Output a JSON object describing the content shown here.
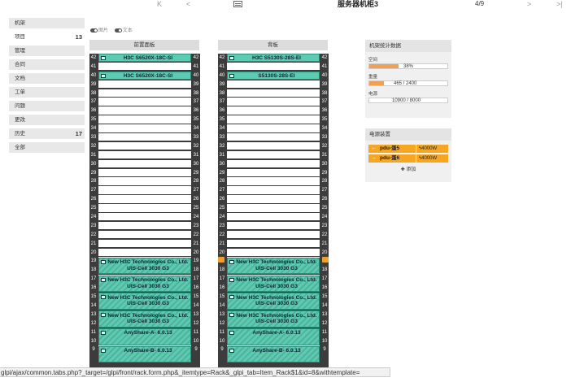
{
  "nav": {
    "first": "K",
    "prev": "<",
    "next": ">",
    "last": ">|",
    "title": "服务器机柜3",
    "counter": "4/9"
  },
  "sidebar": {
    "items": [
      {
        "label": "机架",
        "badge": ""
      },
      {
        "label": "项目",
        "badge": "13"
      },
      {
        "label": "管理",
        "badge": ""
      },
      {
        "label": "合同",
        "badge": ""
      },
      {
        "label": "文档",
        "badge": ""
      },
      {
        "label": "工单",
        "badge": ""
      },
      {
        "label": "问题",
        "badge": ""
      },
      {
        "label": "更改",
        "badge": ""
      },
      {
        "label": "历史",
        "badge": "17"
      },
      {
        "label": "全部",
        "badge": ""
      }
    ]
  },
  "toggles": {
    "images": "图片",
    "text": "文本"
  },
  "front": {
    "title": "前置面板",
    "devices": [
      {
        "label": "H3C S6520X-18C-SI"
      },
      {
        "label": "H3C S6520X-18C-SI"
      },
      {
        "label": "New H3C Technologies Co., Ltd. UIS-Cell 3030 G3"
      },
      {
        "label": "New H3C Technologies Co., Ltd. UIS-Cell 3030 G3"
      },
      {
        "label": "New H3C Technologies Co., Ltd. UIS-Cell 3030 G3"
      },
      {
        "label": "New H3C Technologies Co., Ltd. UIS-Cell 3030 G3"
      },
      {
        "label": "AnyShare-A- 6.0.13"
      },
      {
        "label": "AnyShare-B- 6.0.13"
      }
    ]
  },
  "back": {
    "title": "背板",
    "devices": [
      {
        "label": "H3C S5130S-28S-EI"
      },
      {
        "label": "S5130S-28S-EI"
      },
      {
        "label": "New H3C Technologies Co., Ltd. UIS-Cell 3030 G3"
      },
      {
        "label": "New H3C Technologies Co., Ltd. UIS-Cell 3030 G3"
      },
      {
        "label": "New H3C Technologies Co., Ltd. UIS-Cell 3030 G3"
      },
      {
        "label": "New H3C Technologies Co., Ltd. UIS-Cell 3030 G3"
      },
      {
        "label": "AnyShare-A- 6.0.13"
      },
      {
        "label": "AnyShare-B- 6.0.13"
      }
    ]
  },
  "stats": {
    "title": "机架统计数据",
    "space": {
      "label": "空间",
      "value": "38%",
      "fill": 0.38
    },
    "weight": {
      "label": "重量",
      "value": "465 / 2400",
      "fill": 0.19
    },
    "power": {
      "label": "电源",
      "value": "10900 / 8000",
      "fill": 0
    }
  },
  "pdu": {
    "title": "电源装置",
    "items": [
      {
        "arrow": "←",
        "name": "pdu-蛋5",
        "power": "ϟ4000W"
      },
      {
        "arrow": "→",
        "name": "pdu-蛋6",
        "power": "ϟ4000W"
      }
    ],
    "add": "✚ 添加"
  },
  "status_url": "glpi/ajax/common.tabs.php?_target=/glpi/front/rack.form.php&_itemtype=Rack&_glpi_tab=Item_Rack$1&id=8&withtemplate="
}
